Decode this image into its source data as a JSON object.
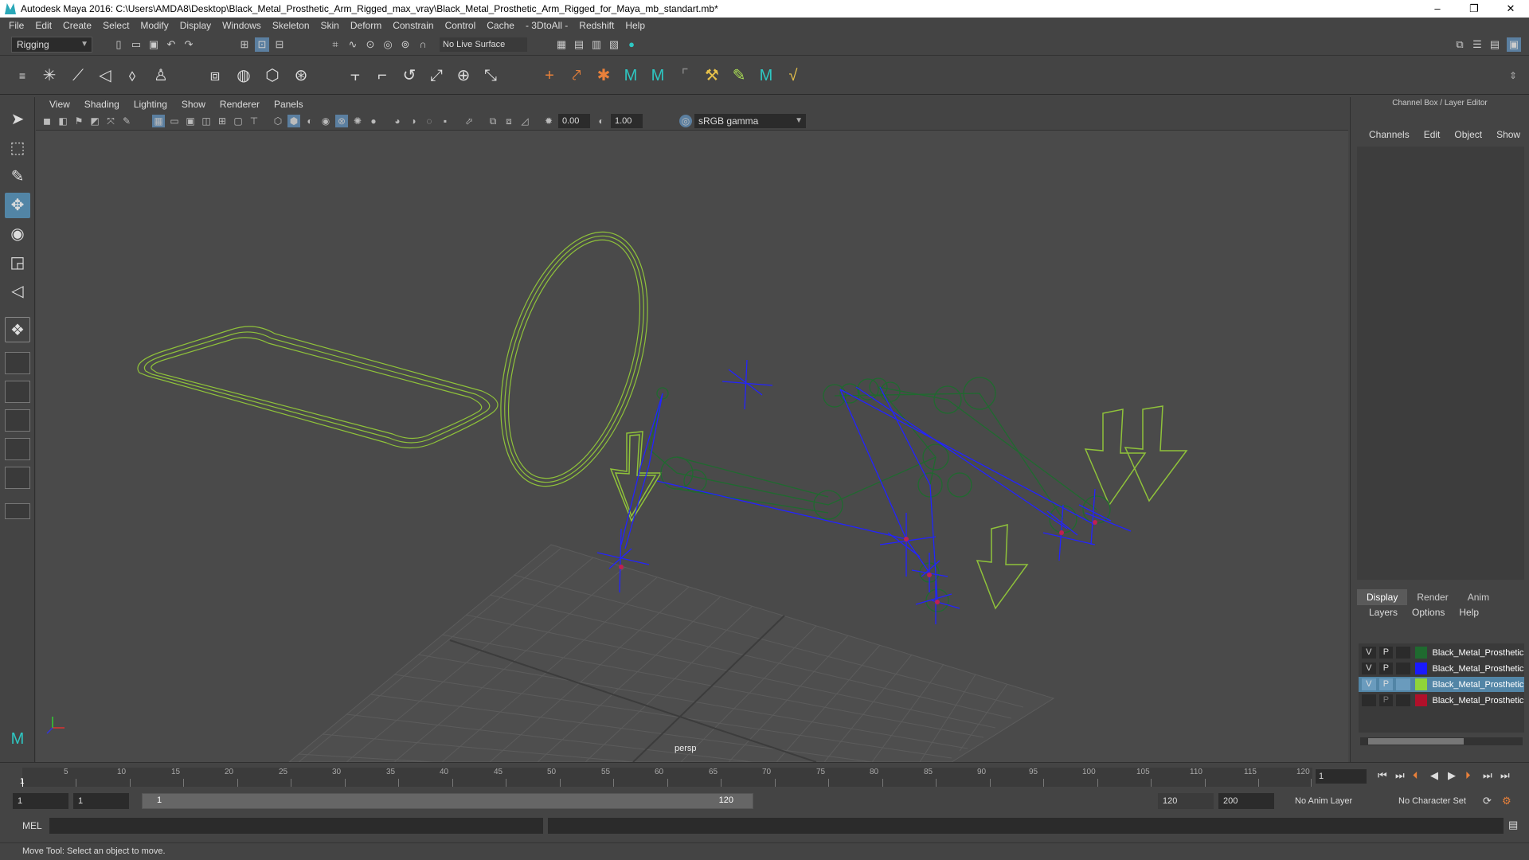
{
  "window": {
    "title": "Autodesk Maya 2016: C:\\Users\\AMDA8\\Desktop\\Black_Metal_Prosthetic_Arm_Rigged_max_vray\\Black_Metal_Prosthetic_Arm_Rigged_for_Maya_mb_standart.mb*",
    "minimize": "–",
    "restore": "❐",
    "close": "✕"
  },
  "menubar": [
    "File",
    "Edit",
    "Create",
    "Select",
    "Modify",
    "Display",
    "Windows",
    "Skeleton",
    "Skin",
    "Deform",
    "Constrain",
    "Control",
    "Cache",
    "- 3DtoAll -",
    "Redshift",
    "Help"
  ],
  "statusline": {
    "mode": "Rigging",
    "live_surface": "No Live Surface"
  },
  "viewport": {
    "menu": [
      "View",
      "Shading",
      "Lighting",
      "Show",
      "Renderer",
      "Panels"
    ],
    "near_value": "0.00",
    "gain_value": "1.00",
    "color_space": "sRGB gamma",
    "camera": "persp"
  },
  "channel_box": {
    "title": "Channel Box / Layer Editor",
    "menu": [
      "Channels",
      "Edit",
      "Object",
      "Show"
    ],
    "tabs": [
      "Display",
      "Render",
      "Anim"
    ],
    "layer_menu": [
      "Layers",
      "Options",
      "Help"
    ],
    "layers": [
      {
        "v": "V",
        "p": "P",
        "color": "#1f6a2f",
        "name": "Black_Metal_Prosthetic",
        "selected": false
      },
      {
        "v": "V",
        "p": "P",
        "color": "#1a1aff",
        "name": "Black_Metal_Prosthetic",
        "selected": false
      },
      {
        "v": "V",
        "p": "P",
        "color": "#8fd43a",
        "name": "Black_Metal_Prosthetic",
        "selected": true
      },
      {
        "v": "",
        "p": "P",
        "color": "#b0102a",
        "name": "Black_Metal_Prosthetic",
        "selected": false
      }
    ]
  },
  "timeline": {
    "ticks": [
      "5",
      "10",
      "15",
      "20",
      "25",
      "30",
      "35",
      "40",
      "45",
      "50",
      "55",
      "60",
      "65",
      "70",
      "75",
      "80",
      "85",
      "90",
      "95",
      "100",
      "105",
      "110",
      "115",
      "120"
    ],
    "start_tick": "1",
    "current_frame": "1"
  },
  "range": {
    "start": "1",
    "playback_start": "1",
    "slider_start": "1",
    "slider_end": "120",
    "playback_end": "120",
    "end": "200",
    "anim_layer": "No Anim Layer",
    "character_set": "No Character Set"
  },
  "command_line": {
    "label": "MEL"
  },
  "status": "Move Tool: Select an object to move."
}
